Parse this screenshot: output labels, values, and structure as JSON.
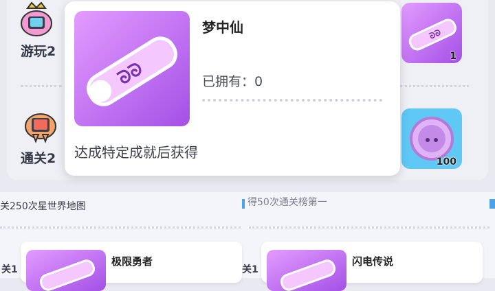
{
  "background_rows": [
    {
      "label": "游玩2"
    },
    {
      "label": "通关2"
    }
  ],
  "rewards": [
    {
      "name": "ticket",
      "count": "1"
    },
    {
      "name": "coin",
      "count": "100"
    }
  ],
  "popup": {
    "title": "梦中仙",
    "owned_label": "已拥有：0",
    "description": "达成特定成就后获得"
  },
  "mid_left_text": "关250次星世界地图",
  "mid_right_text": "得50次通关榜第一",
  "bottom_cards": [
    {
      "title": "极限勇者",
      "side_label": "关1"
    },
    {
      "title": "闪电传说",
      "side_label": "关1"
    }
  ],
  "colors": {
    "ticket_purple_light": "#e39cff",
    "ticket_purple_dark": "#a450e6",
    "coin_blue": "#5fc8f5"
  }
}
